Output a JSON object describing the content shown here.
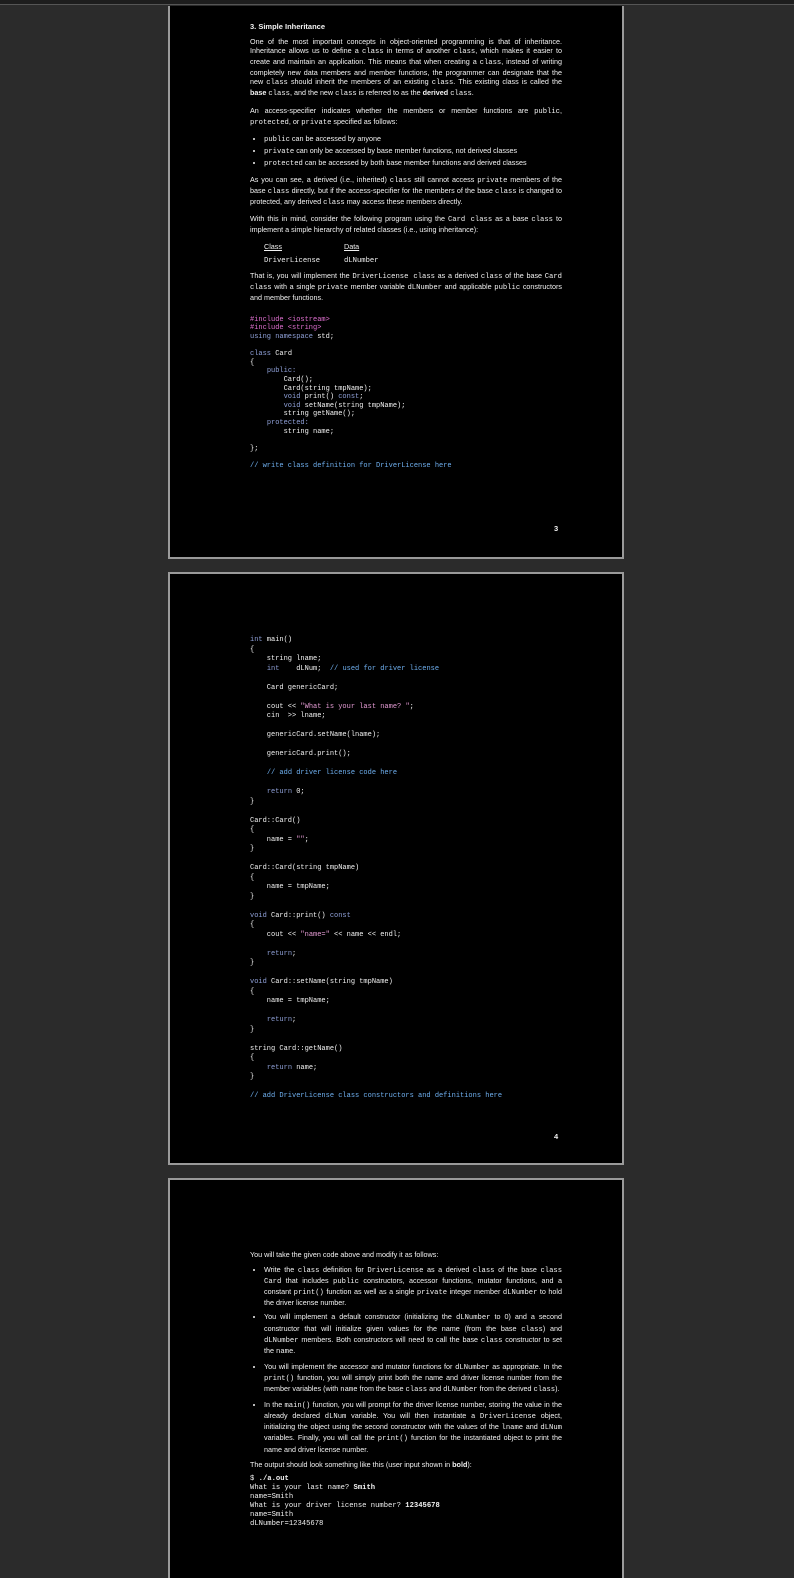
{
  "page1": {
    "section_title": "3.  Simple Inheritance",
    "para1": [
      {
        "t": "One of the most important concepts in object-oriented programming is that of inheritance. Inheritance allows us to define a "
      },
      {
        "c": "class"
      },
      {
        "t": " in terms of another "
      },
      {
        "c": "class"
      },
      {
        "t": ", which makes it easier to create and maintain an application. This means that when creating a "
      },
      {
        "c": "class"
      },
      {
        "t": ", instead of writing completely new data members and member functions, the programmer can designate that the new "
      },
      {
        "c": "class"
      },
      {
        "t": " should inherit the members of an existing "
      },
      {
        "c": "class"
      },
      {
        "t": ". This existing class is called the "
      },
      {
        "b": "base"
      },
      {
        "t": " "
      },
      {
        "c": "class"
      },
      {
        "t": ", and the new "
      },
      {
        "c": "class"
      },
      {
        "t": " is referred to as the "
      },
      {
        "b": "derived"
      },
      {
        "t": " "
      },
      {
        "c": "class"
      },
      {
        "t": "."
      }
    ],
    "para2": [
      {
        "t": "An access-specifier indicates whether the members or member functions are "
      },
      {
        "c": "public"
      },
      {
        "t": ", "
      },
      {
        "c": "protected"
      },
      {
        "t": ", or "
      },
      {
        "c": "private"
      },
      {
        "t": " specified as follows:"
      }
    ],
    "bullets": [
      [
        {
          "c": "public"
        },
        {
          "t": " can be accessed by anyone"
        }
      ],
      [
        {
          "c": "private"
        },
        {
          "t": " can only be accessed by base member functions, not derived classes"
        }
      ],
      [
        {
          "c": "protected"
        },
        {
          "t": " can be accessed by both base member functions and derived classes"
        }
      ]
    ],
    "para3": [
      {
        "t": "As you can see, a derived (i.e., inherited) "
      },
      {
        "c": "class"
      },
      {
        "t": " still cannot access "
      },
      {
        "c": "private"
      },
      {
        "t": " members of the base "
      },
      {
        "c": "class"
      },
      {
        "t": " directly, but if the access-specifier for the members of the base "
      },
      {
        "c": "class"
      },
      {
        "t": " is changed to protected, any derived "
      },
      {
        "c": "class"
      },
      {
        "t": " may access these members directly."
      }
    ],
    "para4": [
      {
        "t": "With this in mind, consider the following program using the "
      },
      {
        "c": "Card class"
      },
      {
        "t": " as a base "
      },
      {
        "c": "class"
      },
      {
        "t": " to implement a simple hierarchy of related classes (i.e., using inheritance):"
      }
    ],
    "table": {
      "headers": [
        "Class",
        "Data"
      ],
      "row": [
        "DriverLicense",
        "dLNumber"
      ]
    },
    "para5": [
      {
        "t": "That is, you will implement the "
      },
      {
        "c": "DriverLicense class"
      },
      {
        "t": " as a derived "
      },
      {
        "c": "class"
      },
      {
        "t": " of the base "
      },
      {
        "c": "Card class"
      },
      {
        "t": " with a single "
      },
      {
        "c": "private"
      },
      {
        "t": " member variable "
      },
      {
        "c": "dLNumber"
      },
      {
        "t": " and applicable "
      },
      {
        "c": "public"
      },
      {
        "t": " constructors and member functions."
      }
    ],
    "code": [
      [
        {
          "k": "pp",
          "t": "#include <iostream>"
        }
      ],
      [
        {
          "k": "pp",
          "t": "#include <string>"
        }
      ],
      [
        {
          "k": "kw2",
          "t": "using namespace"
        },
        {
          "t": " std;"
        }
      ],
      [],
      [
        {
          "k": "kw2",
          "t": "class"
        },
        {
          "t": " Card"
        }
      ],
      [
        {
          "t": "{"
        }
      ],
      [
        {
          "t": "    "
        },
        {
          "k": "kw2",
          "t": "public:"
        }
      ],
      [
        {
          "t": "        Card();"
        }
      ],
      [
        {
          "t": "        Card(string tmpName);"
        }
      ],
      [
        {
          "t": "        "
        },
        {
          "k": "kw2",
          "t": "void"
        },
        {
          "t": " print() "
        },
        {
          "k": "kw2",
          "t": "const"
        },
        {
          "t": ";"
        }
      ],
      [
        {
          "t": "        "
        },
        {
          "k": "kw2",
          "t": "void"
        },
        {
          "t": " setName(string tmpName);"
        }
      ],
      [
        {
          "t": "        string getName();"
        }
      ],
      [
        {
          "t": "    "
        },
        {
          "k": "kw2",
          "t": "protected:"
        }
      ],
      [
        {
          "t": "        string name;"
        }
      ],
      [],
      [
        {
          "t": "};"
        }
      ],
      [],
      [
        {
          "k": "cmt",
          "t": "// write class definition for DriverLicense here"
        }
      ]
    ],
    "page_number": "3"
  },
  "page2": {
    "code": [
      [
        {
          "k": "kw2",
          "t": "int"
        },
        {
          "t": " main()"
        }
      ],
      [
        {
          "t": "{"
        }
      ],
      [
        {
          "t": "    string lname;"
        }
      ],
      [
        {
          "t": "    "
        },
        {
          "k": "kw2",
          "t": "int"
        },
        {
          "t": "    dLNum;  "
        },
        {
          "k": "cmt",
          "t": "// used for driver license"
        }
      ],
      [],
      [
        {
          "t": "    Card genericCard;"
        }
      ],
      [],
      [
        {
          "t": "    cout << "
        },
        {
          "k": "str",
          "t": "\"What is your last name? \""
        },
        {
          "t": ";"
        }
      ],
      [
        {
          "t": "    cin  >> lname;"
        }
      ],
      [],
      [
        {
          "t": "    genericCard.setName(lname);"
        }
      ],
      [],
      [
        {
          "t": "    genericCard.print();"
        }
      ],
      [],
      [
        {
          "t": "    "
        },
        {
          "k": "cmt",
          "t": "// add driver license code here"
        }
      ],
      [],
      [
        {
          "t": "    "
        },
        {
          "k": "kw2",
          "t": "return"
        },
        {
          "t": " 0;"
        }
      ],
      [
        {
          "t": "}"
        }
      ],
      [],
      [
        {
          "t": "Card::Card()"
        }
      ],
      [
        {
          "t": "{"
        }
      ],
      [
        {
          "t": "    name = "
        },
        {
          "k": "str",
          "t": "\"\""
        },
        {
          "t": ";"
        }
      ],
      [
        {
          "t": "}"
        }
      ],
      [],
      [
        {
          "t": "Card::Card(string tmpName)"
        }
      ],
      [
        {
          "t": "{"
        }
      ],
      [
        {
          "t": "    name = tmpName;"
        }
      ],
      [
        {
          "t": "}"
        }
      ],
      [],
      [
        {
          "k": "kw2",
          "t": "void"
        },
        {
          "t": " Card::print() "
        },
        {
          "k": "kw2",
          "t": "const"
        }
      ],
      [
        {
          "t": "{"
        }
      ],
      [
        {
          "t": "    cout << "
        },
        {
          "k": "str",
          "t": "\"name=\""
        },
        {
          "t": " << name << endl;"
        }
      ],
      [],
      [
        {
          "t": "    "
        },
        {
          "k": "kw2",
          "t": "return"
        },
        {
          "t": ";"
        }
      ],
      [
        {
          "t": "}"
        }
      ],
      [],
      [
        {
          "k": "kw2",
          "t": "void"
        },
        {
          "t": " Card::setName(string tmpName)"
        }
      ],
      [
        {
          "t": "{"
        }
      ],
      [
        {
          "t": "    name = tmpName;"
        }
      ],
      [],
      [
        {
          "t": "    "
        },
        {
          "k": "kw2",
          "t": "return"
        },
        {
          "t": ";"
        }
      ],
      [
        {
          "t": "}"
        }
      ],
      [],
      [
        {
          "t": "string Card::getName()"
        }
      ],
      [
        {
          "t": "{"
        }
      ],
      [
        {
          "t": "    "
        },
        {
          "k": "kw2",
          "t": "return"
        },
        {
          "t": " name;"
        }
      ],
      [
        {
          "t": "}"
        }
      ],
      [],
      [
        {
          "k": "cmt",
          "t": "// add DriverLicense class constructors and definitions here"
        }
      ]
    ],
    "page_number": "4"
  },
  "page3": {
    "intro": "You will take the given code above and modify it as follows:",
    "bullets": [
      [
        {
          "t": "Write the "
        },
        {
          "c": "class"
        },
        {
          "t": " definition for "
        },
        {
          "c": "DriverLicense"
        },
        {
          "t": " as a derived "
        },
        {
          "c": "class"
        },
        {
          "t": " of the base "
        },
        {
          "c": "class Card"
        },
        {
          "t": " that includes "
        },
        {
          "c": "public"
        },
        {
          "t": " constructors, accessor functions, mutator functions, and a constant "
        },
        {
          "c": "print()"
        },
        {
          "t": " function as well as a single "
        },
        {
          "c": "private"
        },
        {
          "t": " integer member "
        },
        {
          "c": "dLNumber"
        },
        {
          "t": " to hold the driver license number."
        }
      ],
      [
        {
          "t": "You will implement a default constructor (initializing the "
        },
        {
          "c": "dLNumber"
        },
        {
          "t": " to 0) and a second constructor that will initialize given values for the name (from the base "
        },
        {
          "c": "class"
        },
        {
          "t": ") and "
        },
        {
          "c": "dLNumber"
        },
        {
          "t": " members. Both constructors will need to call the base "
        },
        {
          "c": "class"
        },
        {
          "t": " constructor to set the "
        },
        {
          "c": "name"
        },
        {
          "t": "."
        }
      ],
      [
        {
          "t": "You will implement the accessor and mutator functions for "
        },
        {
          "c": "dLNumber"
        },
        {
          "t": " as appropriate. In the "
        },
        {
          "c": "print()"
        },
        {
          "t": " function, you will simply print both the name and driver license number from the member variables (with "
        },
        {
          "c": "name"
        },
        {
          "t": " from the base "
        },
        {
          "c": "class"
        },
        {
          "t": " and "
        },
        {
          "c": "dLNumber"
        },
        {
          "t": " from the derived "
        },
        {
          "c": "class"
        },
        {
          "t": ")."
        }
      ],
      [
        {
          "t": "In the "
        },
        {
          "c": "main()"
        },
        {
          "t": " function, you will prompt for the driver license number, storing the value in the already declared "
        },
        {
          "c": "dLNum"
        },
        {
          "t": " variable. You will then instantiate a "
        },
        {
          "c": "DriverLicense"
        },
        {
          "t": " object, initializing the object using the second constructor with the values of the "
        },
        {
          "c": "lname"
        },
        {
          "t": " and "
        },
        {
          "c": "dLNum"
        },
        {
          "t": " variables. Finally, you will call the "
        },
        {
          "c": "print()"
        },
        {
          "t": " function for the instantiated object to print the name and driver license number."
        }
      ]
    ],
    "output_intro": [
      {
        "t": "The output should look something like this (user input shown in "
      },
      {
        "b": "bold"
      },
      {
        "t": "):"
      }
    ],
    "output": [
      [
        {
          "t": "$ "
        },
        {
          "b": "./a.out"
        }
      ],
      [
        {
          "t": "What is your last name? "
        },
        {
          "b": "Smith"
        }
      ],
      [
        {
          "t": "name=Smith"
        }
      ],
      [
        {
          "t": "What is your driver license number? "
        },
        {
          "b": "12345678"
        }
      ],
      [
        {
          "t": "name=Smith"
        }
      ],
      [
        {
          "t": "dLNumber=12345678"
        }
      ]
    ]
  }
}
